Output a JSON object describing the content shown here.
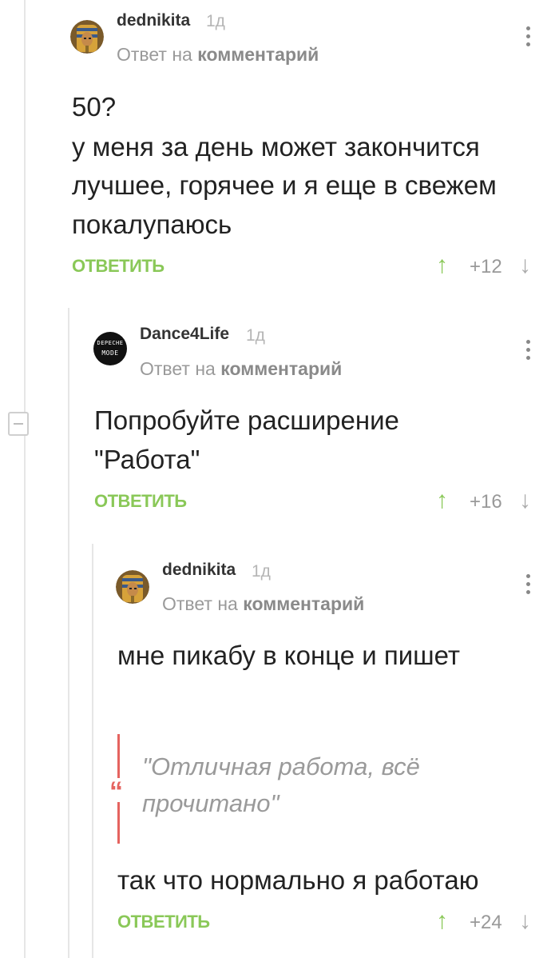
{
  "comments": [
    {
      "author": "dednikita",
      "time": "1д",
      "reply_prefix": "Ответ на",
      "reply_target": "комментарий",
      "text_lines": [
        "50?",
        "у меня за день может закончится",
        "лучшее, горячее и я еще в свежем",
        "покалупаюсь"
      ],
      "reply_label": "ОТВЕТИТЬ",
      "rating": "+12",
      "avatar_icon": "pharaoh-avatar-icon"
    },
    {
      "author": "Dance4Life",
      "time": "1д",
      "reply_prefix": "Ответ на",
      "reply_target": "комментарий",
      "text_lines": [
        "Попробуйте расширение",
        "\"Работа\""
      ],
      "reply_label": "ОТВЕТИТЬ",
      "rating": "+16",
      "avatar_icon": "depeche-mode-avatar-icon",
      "avatar_text": [
        "DEPECHE",
        "MODE"
      ]
    },
    {
      "author": "dednikita",
      "time": "1д",
      "reply_prefix": "Ответ на",
      "reply_target": "комментарий",
      "text_lines": [
        "мне пикабу в конце и пишет"
      ],
      "quote_lines": [
        "\"Отличная работа, всё",
        "прочитано\""
      ],
      "after_quote": "так что нормально я работаю",
      "reply_label": "ОТВЕТИТЬ",
      "rating": "+24",
      "avatar_icon": "pharaoh-avatar-icon"
    }
  ],
  "colors": {
    "accent_green": "#8ac858",
    "quote_red": "#e5635f",
    "muted": "#9a9a9a"
  }
}
